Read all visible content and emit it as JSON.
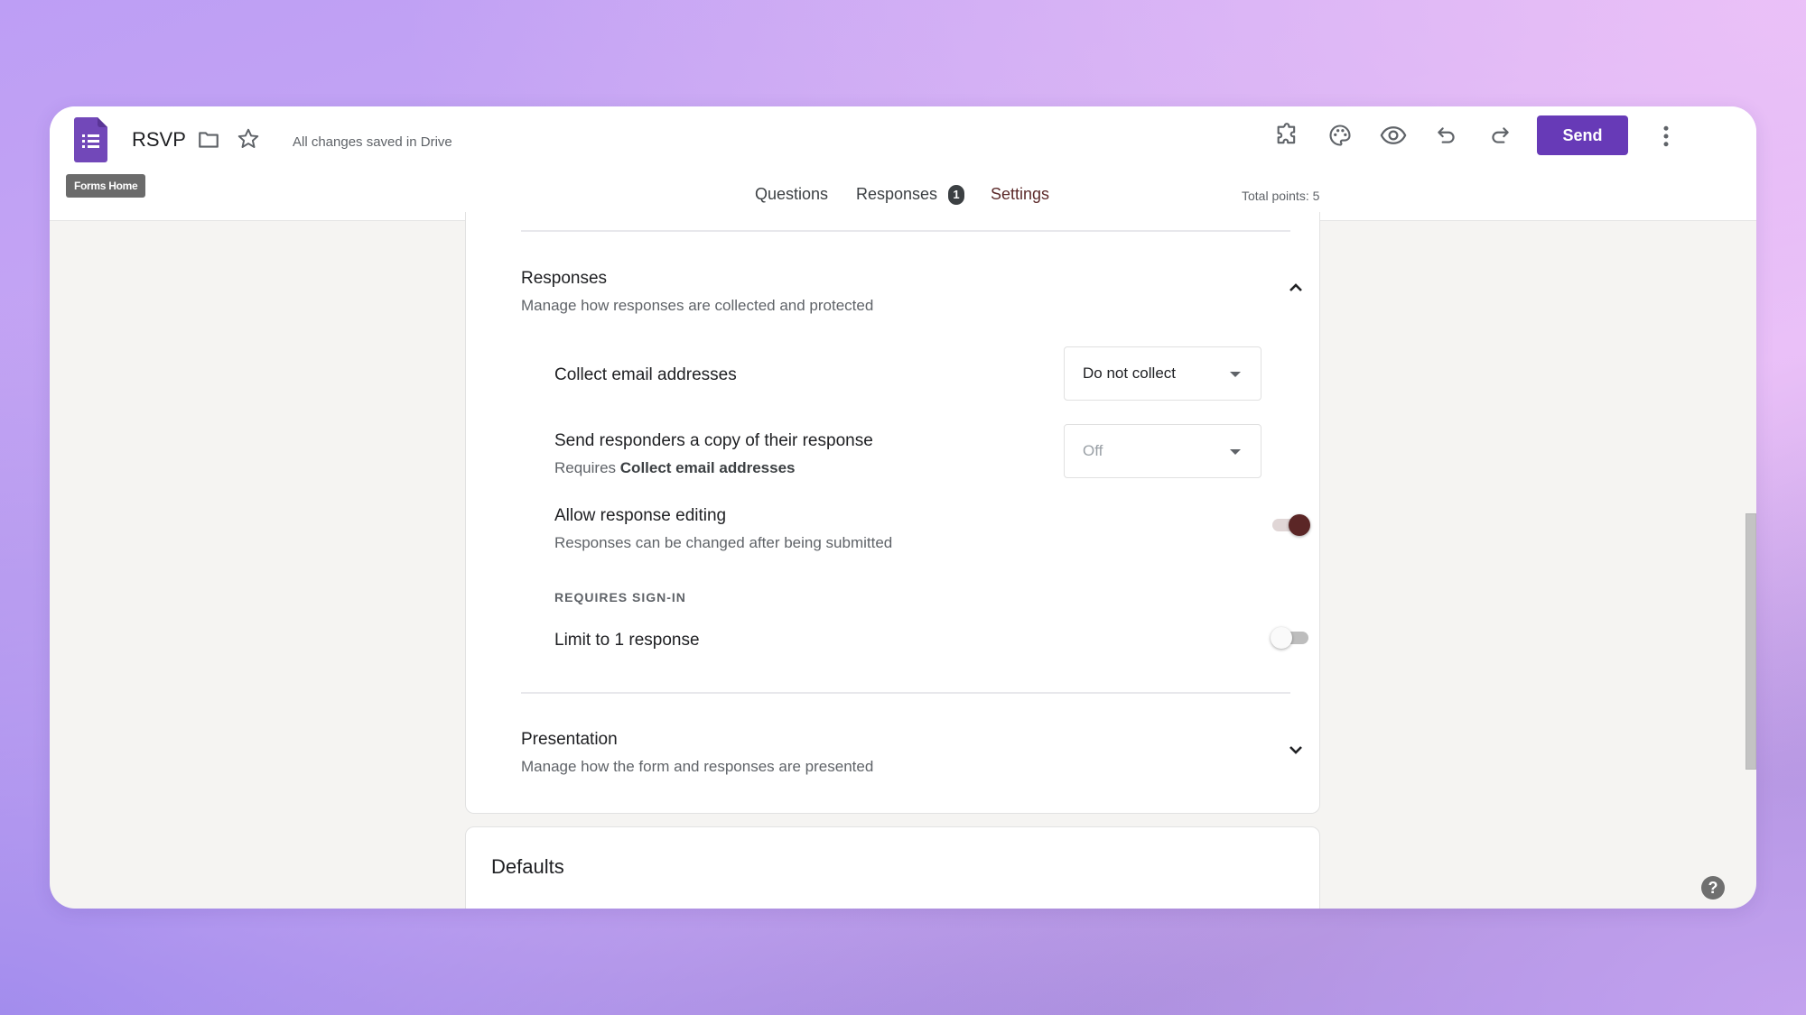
{
  "header": {
    "app_logo": "google-forms-icon",
    "doc_title": "RSVP",
    "save_status": "All changes saved in Drive",
    "tooltip": "Forms Home",
    "toolbar_icons": [
      "addons-icon",
      "palette-icon",
      "preview-eye-icon",
      "undo-icon",
      "redo-icon"
    ],
    "send_label": "Send",
    "more_icon": "more-vert-icon",
    "brand_color": "#673ab7"
  },
  "tabs": [
    {
      "label": "Questions",
      "active": false
    },
    {
      "label": "Responses",
      "active": false,
      "badge": "1"
    },
    {
      "label": "Settings",
      "active": true
    }
  ],
  "total_points": "Total points: 5",
  "responses_section": {
    "title": "Responses",
    "subtitle": "Manage how responses are collected and protected",
    "expanded": true,
    "settings": {
      "collect_email": {
        "label": "Collect email addresses",
        "value": "Do not collect"
      },
      "send_copy": {
        "label": "Send responders a copy of their response",
        "requires_prefix": "Requires",
        "requires_bold": "Collect email addresses",
        "value": "Off",
        "disabled": true
      },
      "allow_editing": {
        "label": "Allow response editing",
        "subtitle": "Responses can be changed after being submitted",
        "enabled": true
      },
      "group_label": "REQUIRES SIGN-IN",
      "limit_one": {
        "label": "Limit to 1 response",
        "enabled": false
      }
    }
  },
  "presentation_section": {
    "title": "Presentation",
    "subtitle": "Manage how the form and responses are presented",
    "expanded": false
  },
  "defaults_section": {
    "title": "Defaults"
  },
  "help_label": "?",
  "accent_color": "#5b2626"
}
